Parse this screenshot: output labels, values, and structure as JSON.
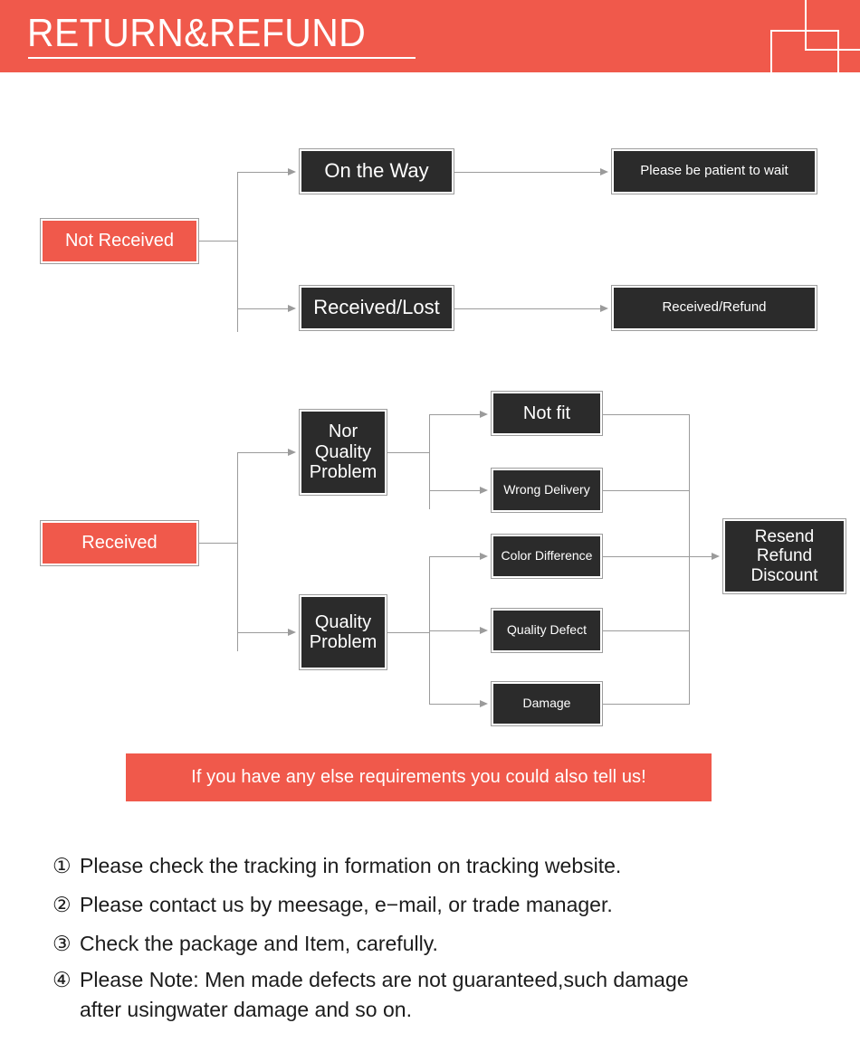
{
  "header": {
    "title": "RETURN&REFUND",
    "background_color": "#F0594B",
    "text_color": "#FFFFFF",
    "decoration": [
      "rect-outline-top-right",
      "rect-outline-lower-right"
    ]
  },
  "colors": {
    "accent_red": "#F0594B",
    "node_dark": "#2B2B2B",
    "node_border": "#9D9D9D",
    "connector": "#9B9B9B",
    "body_text": "#1C1C1C"
  },
  "flow": {
    "not_received": {
      "label": "Not Received",
      "branches": [
        {
          "label": "On the Way",
          "result": "Please be patient to wait"
        },
        {
          "label": "Received/Lost",
          "result": "Received/Refund"
        }
      ]
    },
    "received": {
      "label": "Received",
      "branches": [
        {
          "label": "Nor\nQuality\nProblem",
          "reasons": [
            "Not fit",
            "Wrong Delivery"
          ]
        },
        {
          "label": "Quality\nProblem",
          "reasons": [
            "Color Difference",
            "Quality Defect",
            "Damage"
          ]
        }
      ],
      "outcome": "Resend\nRefund\nDiscount"
    }
  },
  "notice": {
    "text": "If you have any else requirements you could also tell us!"
  },
  "notes": [
    {
      "number": "①",
      "text": "Please check the tracking in formation on tracking website."
    },
    {
      "number": "②",
      "text": "Please contact us by meesage, e−mail, or trade manager."
    },
    {
      "number": "③",
      "text": "Check the package and Item, carefully."
    },
    {
      "number": "④",
      "text": "Please Note: Men made defects are not guaranteed,such damage\nafter usingwater damage and so on."
    }
  ]
}
